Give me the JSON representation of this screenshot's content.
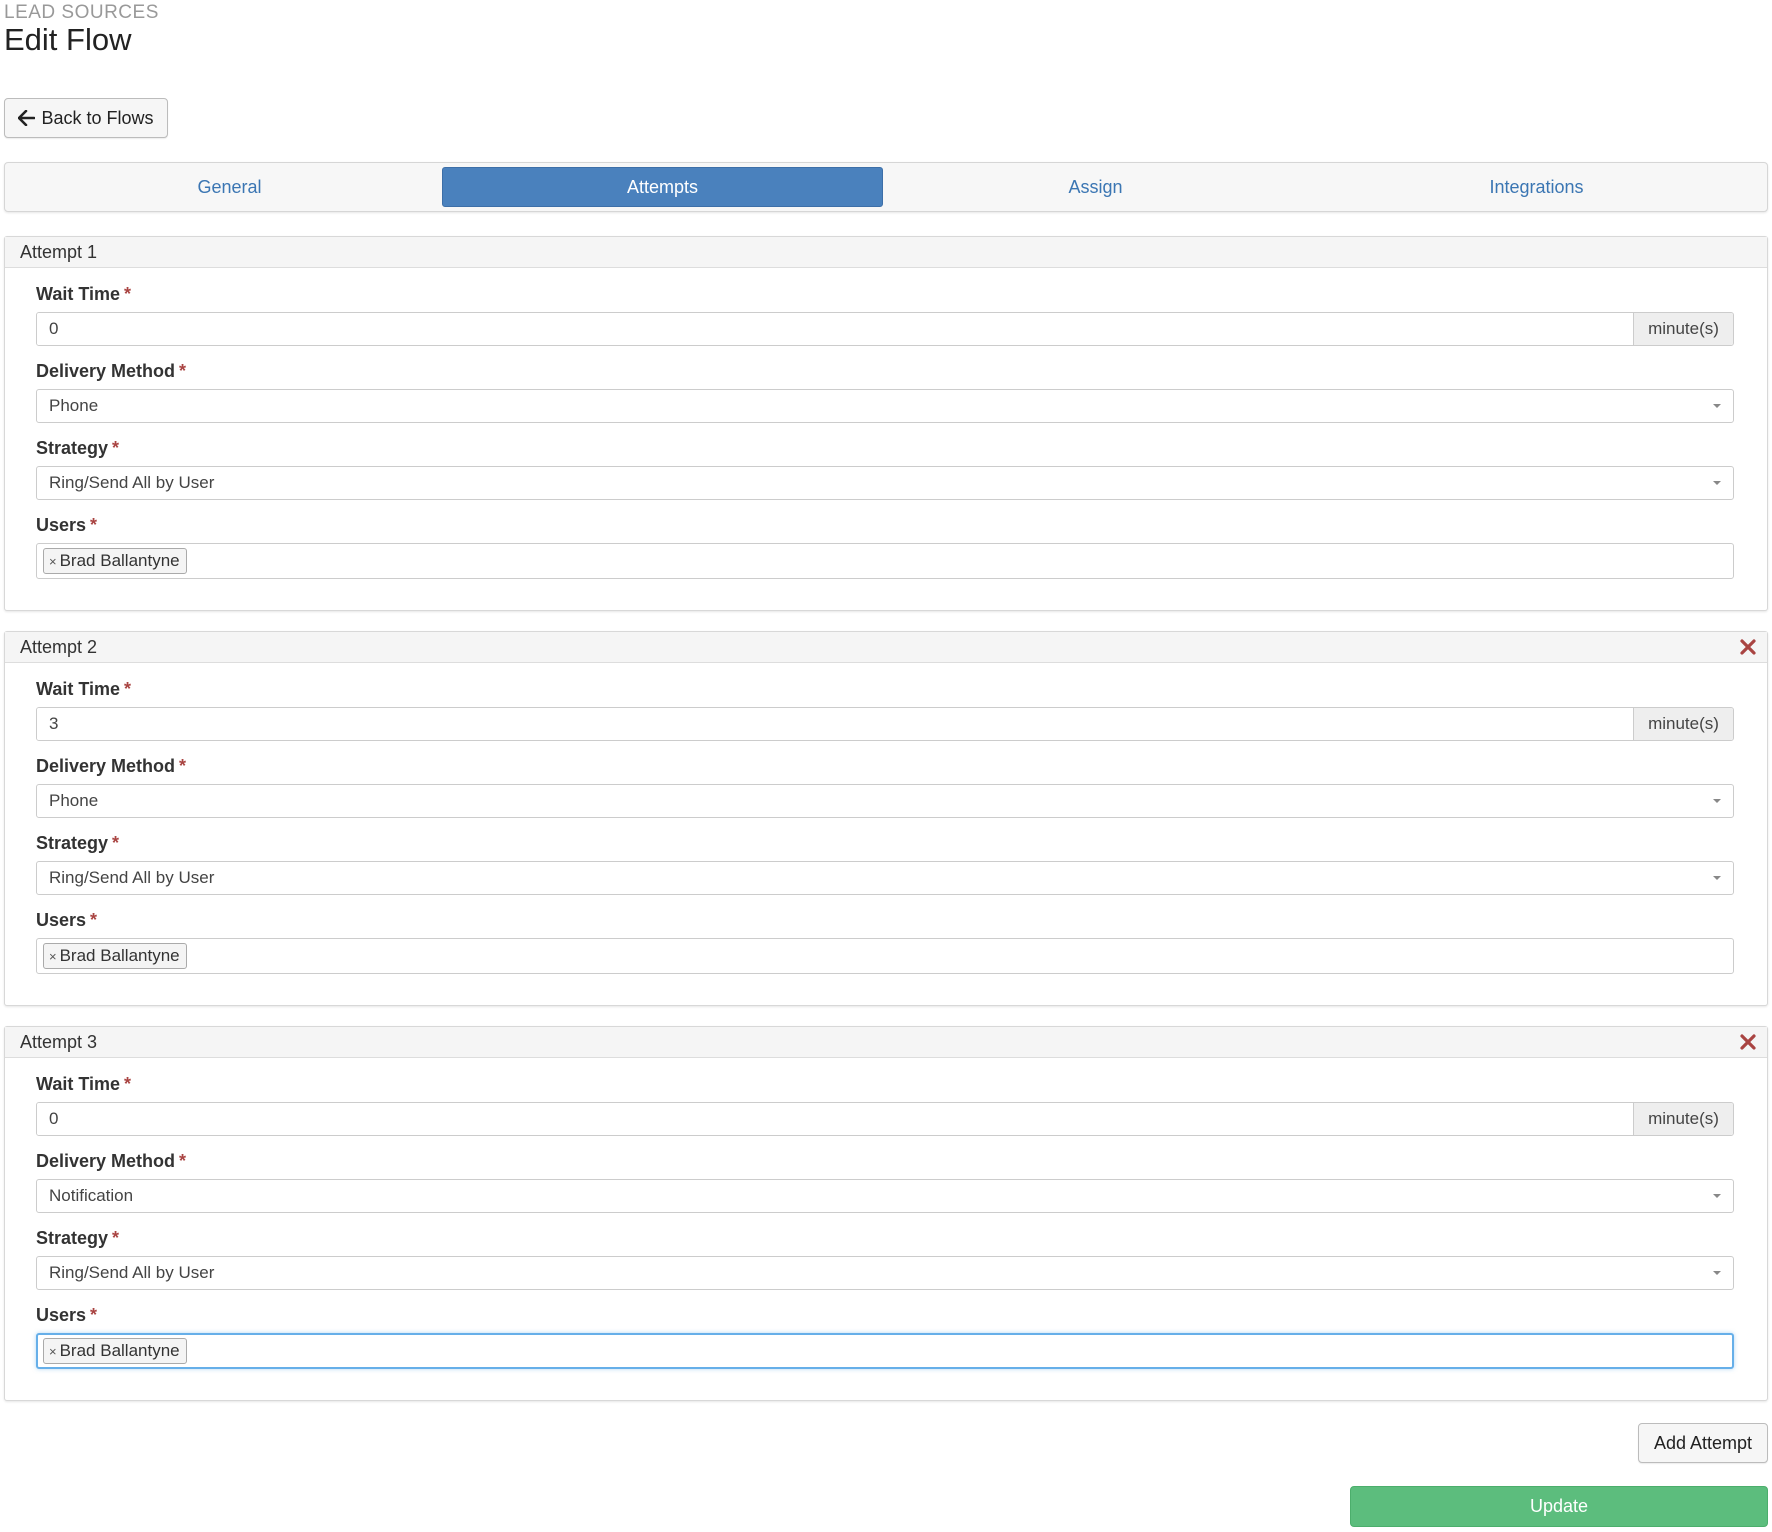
{
  "header": {
    "section": "LEAD SOURCES",
    "title": "Edit Flow",
    "back_label": "Back to Flows"
  },
  "tabs": [
    {
      "label": "General",
      "active": false
    },
    {
      "label": "Attempts",
      "active": true
    },
    {
      "label": "Assign",
      "active": false
    },
    {
      "label": "Integrations",
      "active": false
    }
  ],
  "labels": {
    "wait_time": "Wait Time",
    "delivery_method": "Delivery Method",
    "strategy": "Strategy",
    "users": "Users",
    "required_marker": "*",
    "wait_unit": "minute(s)"
  },
  "attempts": [
    {
      "title": "Attempt 1",
      "wait_time": "0",
      "delivery_method": "Phone",
      "strategy": "Ring/Send All by User",
      "users": [
        "Brad Ballantyne"
      ],
      "removable": false
    },
    {
      "title": "Attempt 2",
      "wait_time": "3",
      "delivery_method": "Phone",
      "strategy": "Ring/Send All by User",
      "users": [
        "Brad Ballantyne"
      ],
      "removable": true
    },
    {
      "title": "Attempt 3",
      "wait_time": "0",
      "delivery_method": "Notification",
      "strategy": "Ring/Send All by User",
      "users": [
        "Brad Ballantyne"
      ],
      "removable": true
    }
  ],
  "actions": {
    "add_attempt": "Add Attempt",
    "update": "Update"
  },
  "icons": {
    "back": "arrow-left-icon",
    "remove_attempt": "close-icon",
    "remove_user": "tag-remove-icon",
    "select_toggle": "caret-down-icon"
  },
  "colors": {
    "tab_active": "#4a81bd",
    "link": "#3b76b3",
    "update_button": "#5cbd7d",
    "remove_icon": "#a94442",
    "focus_border": "#66afe9"
  }
}
